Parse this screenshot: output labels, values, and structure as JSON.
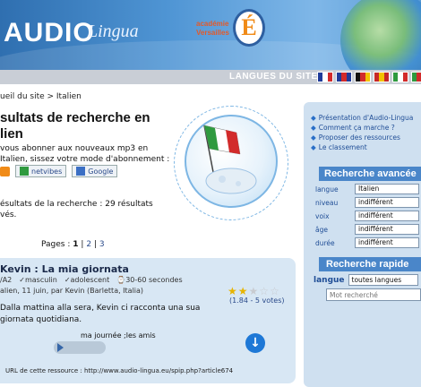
{
  "header": {
    "logo_main": "AUDIO",
    "logo_sub": "Lingua",
    "academie": "académie\nVersailles",
    "rf_letter": "É",
    "sitebar_label": "LANGUES DU SITE",
    "flags": [
      {
        "name": "france-flag",
        "colors": [
          "#1f3b9a",
          "#ffffff",
          "#d22b2b"
        ]
      },
      {
        "name": "uk-flag",
        "colors": [
          "#1f3b9a",
          "#d22b2b",
          "#1f3b9a"
        ]
      },
      {
        "name": "germany-flag",
        "colors": [
          "#111111",
          "#d22b2b",
          "#f2c200"
        ]
      },
      {
        "name": "spain-flag",
        "colors": [
          "#c62828",
          "#f2c200",
          "#c62828"
        ]
      },
      {
        "name": "italy-flag",
        "colors": [
          "#2f9a3f",
          "#ffffff",
          "#d22b2b"
        ]
      },
      {
        "name": "portugal-flag",
        "colors": [
          "#2f9a3f",
          "#d22b2b",
          "#d22b2b"
        ]
      }
    ]
  },
  "breadcrumb": "ueil du site > Italien",
  "main": {
    "title": "sultats de recherche en lien",
    "intro": "vous abonner aux nouveaux mp3 en Italien, sissez votre mode d'abonnement :",
    "subscribe": {
      "netvibes": "netvibes",
      "google": "Google"
    },
    "results_text": "ésultats de la recherche : 29 résultats vés.",
    "pages_label": "Pages :",
    "pages": [
      "1",
      "2",
      "3"
    ],
    "pages_sep": "|"
  },
  "result": {
    "title": "Kevin : La mia giornata",
    "tags": [
      "/A2",
      "✓masculin",
      "✓adolescent",
      "⌚30-60 secondes"
    ],
    "meta": "alien, 11 juin, par Kevin (Barletta, Italia)",
    "rating": 2.5,
    "stars": [
      "★",
      "★",
      "★",
      "☆",
      "☆"
    ],
    "votes": "(1.84 - 5 votes)",
    "description": "Dalla mattina alla sera, Kevin ci racconta una sua giornata quotidiana.",
    "audio_label": "ma journée ;les amis",
    "download": "↓",
    "url_line": "URL de cette ressource : http://www.audio-lingua.eu/spip.php?article674"
  },
  "sidebar": {
    "links": [
      "Présentation d'Audio-Lingua",
      "Comment ça marche ?",
      "Proposer des ressources",
      "Le classement"
    ],
    "advanced": {
      "title": "Recherche avancée",
      "rows": [
        {
          "label": "langue",
          "value": "Italien"
        },
        {
          "label": "niveau",
          "value": "indifférent"
        },
        {
          "label": "voix",
          "value": "indifférent"
        },
        {
          "label": "âge",
          "value": "indifférent"
        },
        {
          "label": "durée",
          "value": "indifférent"
        }
      ]
    },
    "quick": {
      "title": "Recherche rapide",
      "label": "langue",
      "value": "toutes langues",
      "input_placeholder": "Mot recherché"
    }
  }
}
